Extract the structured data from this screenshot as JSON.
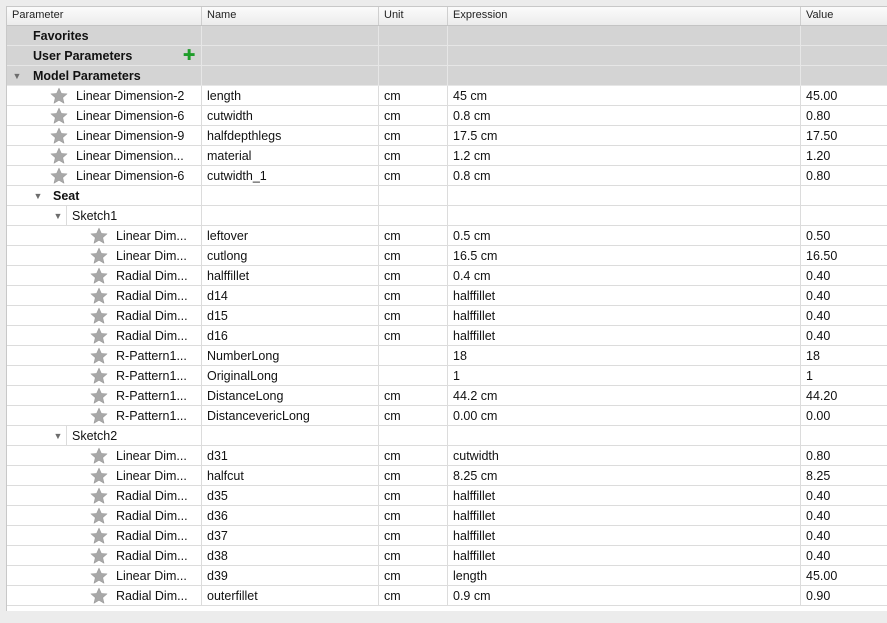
{
  "columns": {
    "parameter": "Parameter",
    "name": "Name",
    "unit": "Unit",
    "expression": "Expression",
    "value": "Value"
  },
  "groups": {
    "favorites": "Favorites",
    "user_parameters": "User Parameters",
    "model_parameters": "Model Parameters"
  },
  "icons": {
    "favorite_star": "star-icon",
    "add": "plus-icon",
    "expand": "disclosure-triangle-icon"
  },
  "colors": {
    "group_row": "#d4d4d4",
    "add_icon": "#1f9d2a",
    "star": "#a8a8a8"
  },
  "model_params": [
    {
      "param": "Linear Dimension-2",
      "name": "length",
      "unit": "cm",
      "expr": "45 cm",
      "value": "45.00"
    },
    {
      "param": "Linear Dimension-6",
      "name": "cutwidth",
      "unit": "cm",
      "expr": "0.8 cm",
      "value": "0.80"
    },
    {
      "param": "Linear Dimension-9",
      "name": "halfdepthlegs",
      "unit": "cm",
      "expr": "17.5 cm",
      "value": "17.50"
    },
    {
      "param": "Linear Dimension...",
      "name": "material",
      "unit": "cm",
      "expr": "1.2 cm",
      "value": "1.20"
    },
    {
      "param": "Linear Dimension-6",
      "name": "cutwidth_1",
      "unit": "cm",
      "expr": "0.8 cm",
      "value": "0.80"
    }
  ],
  "seat": {
    "label": "Seat",
    "sketch1": {
      "label": "Sketch1",
      "rows": [
        {
          "param": "Linear Dim...",
          "name": "leftover",
          "unit": "cm",
          "expr": "0.5 cm",
          "value": "0.50"
        },
        {
          "param": "Linear Dim...",
          "name": "cutlong",
          "unit": "cm",
          "expr": "16.5 cm",
          "value": "16.50"
        },
        {
          "param": "Radial Dim...",
          "name": "halffillet",
          "unit": "cm",
          "expr": "0.4 cm",
          "value": "0.40"
        },
        {
          "param": "Radial Dim...",
          "name": "d14",
          "unit": "cm",
          "expr": "halffillet",
          "value": "0.40"
        },
        {
          "param": "Radial Dim...",
          "name": "d15",
          "unit": "cm",
          "expr": "halffillet",
          "value": "0.40"
        },
        {
          "param": "Radial Dim...",
          "name": "d16",
          "unit": "cm",
          "expr": "halffillet",
          "value": "0.40"
        },
        {
          "param": "R-Pattern1...",
          "name": "NumberLong",
          "unit": "",
          "expr": "18",
          "value": "18"
        },
        {
          "param": "R-Pattern1...",
          "name": "OriginalLong",
          "unit": "",
          "expr": "1",
          "value": "1"
        },
        {
          "param": "R-Pattern1...",
          "name": "DistanceLong",
          "unit": "cm",
          "expr": "44.2 cm",
          "value": "44.20"
        },
        {
          "param": "R-Pattern1...",
          "name": "DistancevericLong",
          "unit": "cm",
          "expr": "0.00 cm",
          "value": "0.00"
        }
      ]
    },
    "sketch2": {
      "label": "Sketch2",
      "rows": [
        {
          "param": "Linear Dim...",
          "name": "d31",
          "unit": "cm",
          "expr": "cutwidth",
          "value": "0.80"
        },
        {
          "param": "Linear Dim...",
          "name": "halfcut",
          "unit": "cm",
          "expr": "8.25 cm",
          "value": "8.25"
        },
        {
          "param": "Radial Dim...",
          "name": "d35",
          "unit": "cm",
          "expr": "halffillet",
          "value": "0.40"
        },
        {
          "param": "Radial Dim...",
          "name": "d36",
          "unit": "cm",
          "expr": "halffillet",
          "value": "0.40"
        },
        {
          "param": "Radial Dim...",
          "name": "d37",
          "unit": "cm",
          "expr": "halffillet",
          "value": "0.40"
        },
        {
          "param": "Radial Dim...",
          "name": "d38",
          "unit": "cm",
          "expr": "halffillet",
          "value": "0.40"
        },
        {
          "param": "Linear Dim...",
          "name": "d39",
          "unit": "cm",
          "expr": "length",
          "value": "45.00"
        },
        {
          "param": "Radial Dim...",
          "name": "outerfillet",
          "unit": "cm",
          "expr": "0.9 cm",
          "value": "0.90"
        }
      ]
    }
  }
}
